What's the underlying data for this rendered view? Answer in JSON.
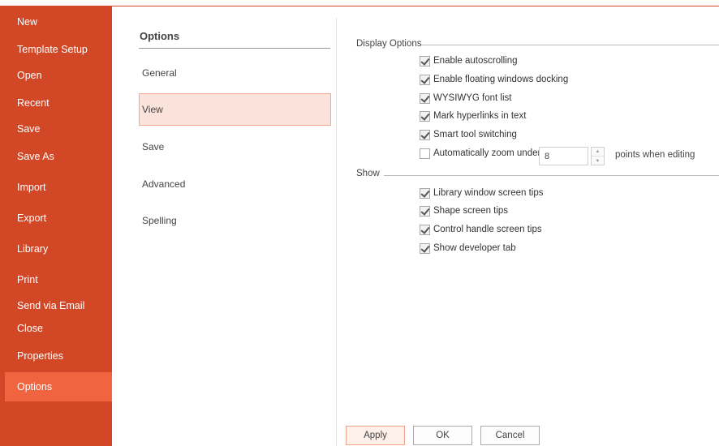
{
  "nav": {
    "items": [
      {
        "label": "New"
      },
      {
        "label": "Template Setup"
      },
      {
        "label": "Open"
      },
      {
        "label": "Recent"
      },
      {
        "label": "Save"
      },
      {
        "label": "Save As"
      },
      {
        "label": "Import"
      },
      {
        "label": "Export"
      },
      {
        "label": "Library"
      },
      {
        "label": "Print"
      },
      {
        "label": "Send via Email"
      },
      {
        "label": "Close"
      },
      {
        "label": "Properties"
      },
      {
        "label": "Options"
      }
    ],
    "selected": "Options"
  },
  "categories": {
    "title": "Options",
    "items": [
      {
        "label": "General"
      },
      {
        "label": "View"
      },
      {
        "label": "Save"
      },
      {
        "label": "Advanced"
      },
      {
        "label": "Spelling"
      }
    ],
    "selected": "View"
  },
  "display_options": {
    "label": "Display Options",
    "enable_autoscrolling": {
      "label": "Enable autoscrolling",
      "checked": true
    },
    "floating_docking": {
      "label": "Enable floating windows docking",
      "checked": true
    },
    "wysiwyg_font_list": {
      "label": "WYSIWYG font list",
      "checked": true
    },
    "mark_hyperlinks": {
      "label": "Mark hyperlinks in text",
      "checked": true
    },
    "smart_tool_switching": {
      "label": "Smart tool switching",
      "checked": true
    },
    "auto_zoom": {
      "label": "Automatically zoom under",
      "checked": false,
      "value": "8",
      "suffix": "points when editing"
    }
  },
  "show": {
    "label": "Show",
    "library_tips": {
      "label": "Library window screen tips",
      "checked": true
    },
    "shape_tips": {
      "label": "Shape screen tips",
      "checked": true
    },
    "control_handle_tips": {
      "label": "Control handle screen tips",
      "checked": true
    },
    "developer_tab": {
      "label": "Show developer tab",
      "checked": true
    }
  },
  "buttons": {
    "apply": "Apply",
    "ok": "OK",
    "cancel": "Cancel"
  },
  "colors": {
    "accent": "#d24726",
    "nav_selected": "#f0643f",
    "category_selected": "#fbe2da"
  }
}
